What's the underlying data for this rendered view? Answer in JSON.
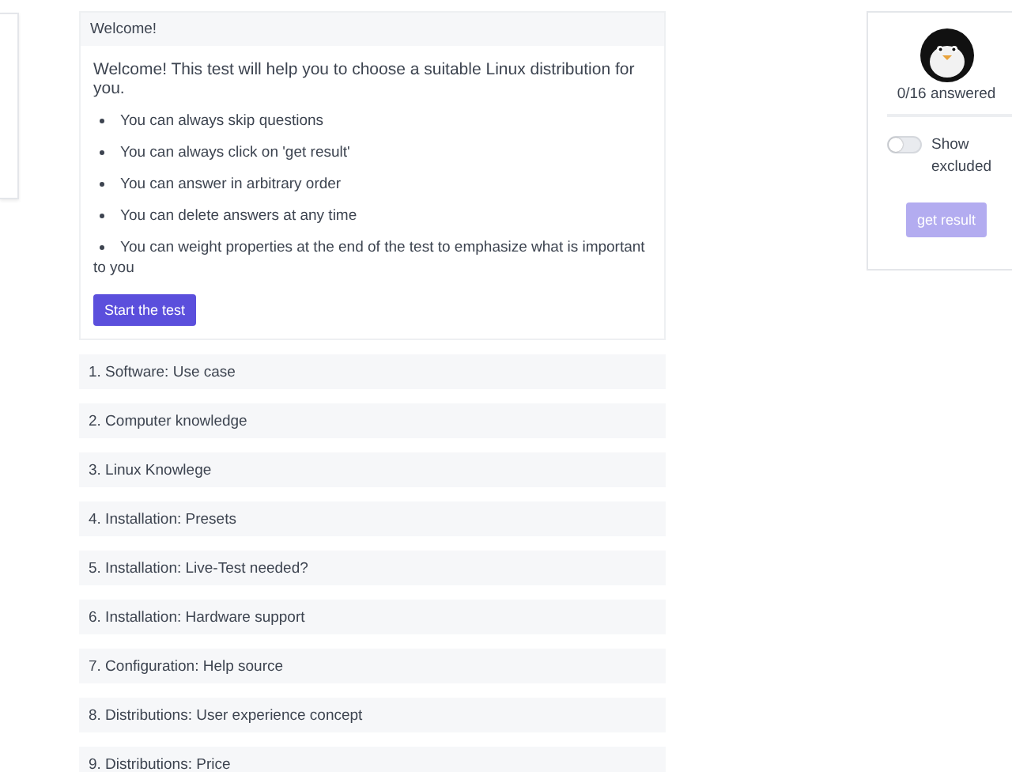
{
  "welcome": {
    "header": "Welcome!",
    "intro": "Welcome! This test will help you to choose a suitable Linux distribution for you.",
    "bullets": [
      "You can always skip questions",
      "You can always click on 'get result'",
      "You can answer in arbitrary order",
      "You can delete answers at any time",
      "You can weight properties at the end of the test to emphasize what is important to you"
    ],
    "button": "Start the test"
  },
  "questions": [
    "1. Software: Use case",
    "2. Computer knowledge",
    "3. Linux Knowlege",
    "4. Installation: Presets",
    "5. Installation: Live-Test needed?",
    "6. Installation: Hardware support",
    "7. Configuration: Help source",
    "8. Distributions: User experience concept",
    "9. Distributions: Price"
  ],
  "sidebar": {
    "progress": "0/16 answered",
    "toggle": {
      "label": "Show excluded",
      "on": false
    },
    "button": {
      "label": "get result",
      "disabled": true
    }
  }
}
